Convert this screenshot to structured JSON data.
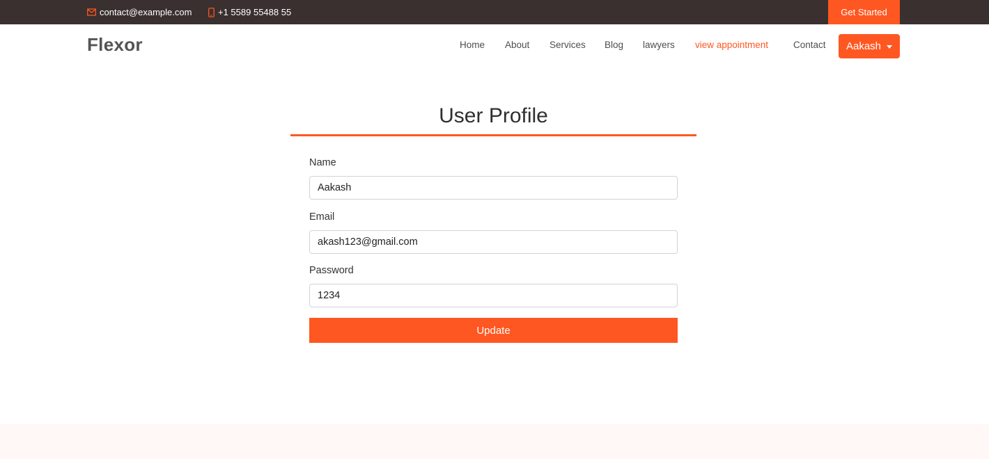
{
  "topbar": {
    "email": "contact@example.com",
    "phone": "+1 5589 55488 55",
    "cta_label": "Get Started",
    "email_icon": "envelope-icon",
    "phone_icon": "phone-icon"
  },
  "header": {
    "logo": "Flexor",
    "nav": [
      {
        "label": "Home"
      },
      {
        "label": "About"
      },
      {
        "label": "Services"
      },
      {
        "label": "Blog"
      },
      {
        "label": "lawyers"
      },
      {
        "label": "view appointment",
        "active": true
      },
      {
        "label": "Contact"
      }
    ],
    "user_menu_label": "Aakash"
  },
  "profile": {
    "title": "User Profile",
    "fields": {
      "name": {
        "label": "Name",
        "value": "Aakash"
      },
      "email": {
        "label": "Email",
        "value": "akash123@gmail.com"
      },
      "password": {
        "label": "Password",
        "value": "1234"
      }
    },
    "submit_label": "Update"
  },
  "colors": {
    "accent": "#ff5721",
    "topbar_bg": "#3a3030",
    "text_dark": "#2f2f2f"
  }
}
